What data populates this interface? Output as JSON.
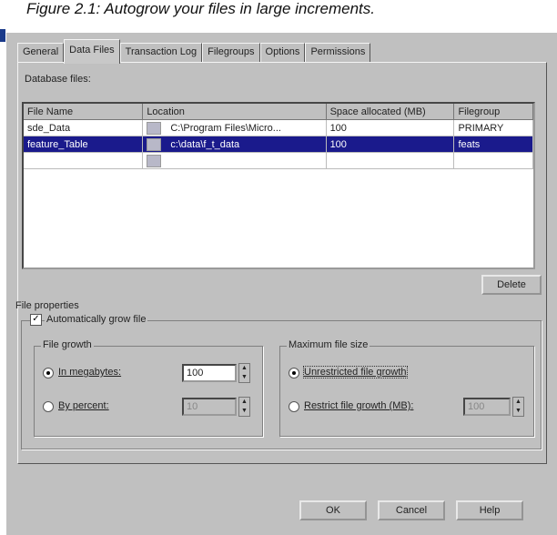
{
  "caption": "Figure 2.1:  Autogrow your files in large increments.",
  "tabs": [
    "General",
    "Data Files",
    "Transaction Log",
    "Filegroups",
    "Options",
    "Permissions"
  ],
  "database_files_label": "Database files:",
  "grid": {
    "headers": [
      "File Name",
      "Location",
      "Space allocated (MB)",
      "Filegroup"
    ],
    "rows": [
      [
        "sde_Data",
        "C:\\Program Files\\Micro...",
        "100",
        "PRIMARY"
      ],
      [
        "feature_Table",
        "c:\\data\\f_t_data",
        "100",
        "feats"
      ],
      [
        "",
        "",
        "",
        ""
      ]
    ]
  },
  "delete_button": "Delete",
  "file_properties_label": "File properties",
  "autogrow_label": "Automatically grow file",
  "file_growth": {
    "title": "File growth",
    "in_megabytes": "In megabytes:",
    "by_percent": "By percent:",
    "mb_value": "100",
    "percent_value": "10"
  },
  "max_size": {
    "title": "Maximum file size",
    "unrestricted": "Unrestricted file growth",
    "restrict": "Restrict file growth (MB):",
    "restrict_value": "100"
  },
  "buttons": {
    "ok": "OK",
    "cancel": "Cancel",
    "help": "Help"
  }
}
